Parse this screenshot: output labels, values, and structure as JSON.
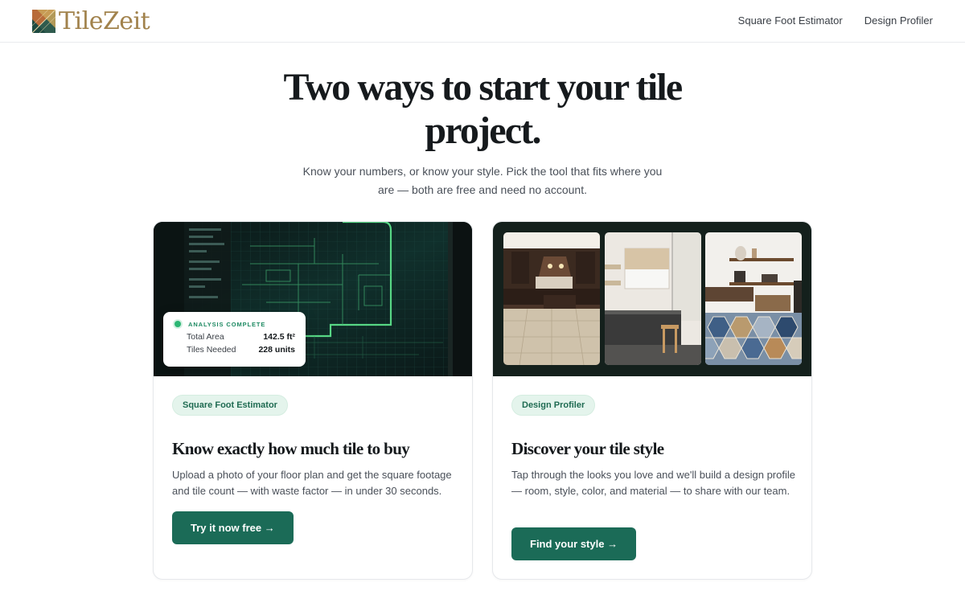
{
  "brand": {
    "name": "TileZeit"
  },
  "nav": {
    "items": [
      "Square Foot Estimator",
      "Design Profiler"
    ]
  },
  "hero": {
    "title": "Two ways to start your tile project.",
    "subtitle": "Know your numbers, or know your style. Pick the tool that fits where you are — both are free and need no account."
  },
  "cards": [
    {
      "tag": "Square Foot Estimator",
      "title": "Know exactly how much tile to buy",
      "description": "Upload a photo of your floor plan and get the square footage and tile count — with waste factor — in under 30 seconds.",
      "cta": "Try it now free →",
      "analysis": {
        "status": "ANALYSIS COMPLETE",
        "rows": [
          {
            "label": "Total Area",
            "value": "142.5 ft²"
          },
          {
            "label": "Tiles Needed",
            "value": "228 units"
          }
        ]
      }
    },
    {
      "tag": "Design Profiler",
      "title": "Discover your tile style",
      "description": "Tap through the looks you love and we'll build a design profile — room, style, color, and material — to share with our team.",
      "cta": "Find your style →"
    }
  ],
  "colors": {
    "accent": "#1b6b57",
    "pill_bg": "#e4f4ec",
    "status_green": "#2bb673",
    "brand_gold": "#a1824c",
    "blueprint_bg": "#0d1b1b",
    "blueprint_line": "#5ce08a",
    "gallery_bg": "#14201c"
  },
  "icons": {
    "logo": "tile-grid-logo-icon",
    "status": "green-dot-icon"
  }
}
